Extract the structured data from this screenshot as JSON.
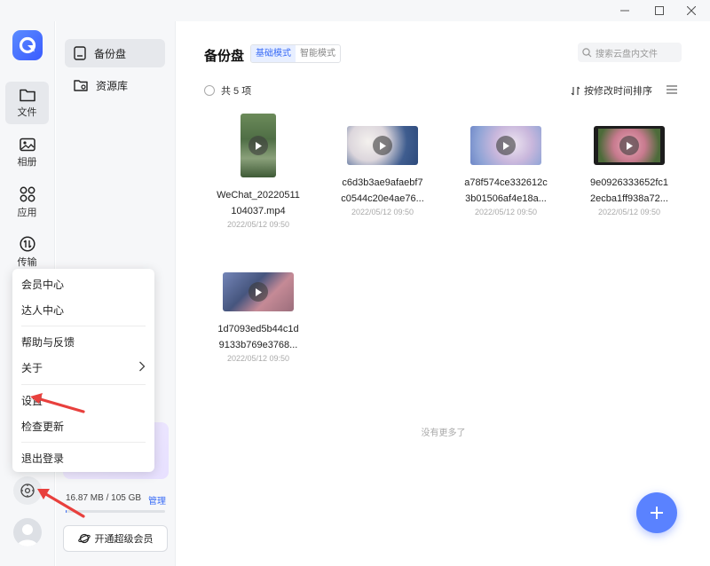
{
  "window": {
    "minimize_icon": "minimize-icon",
    "maximize_icon": "maximize-icon",
    "close_icon": "close-icon"
  },
  "rail": {
    "items": [
      {
        "label": "文件",
        "icon": "folder-icon"
      },
      {
        "label": "相册",
        "icon": "photo-icon"
      },
      {
        "label": "应用",
        "icon": "apps-icon"
      },
      {
        "label": "传输",
        "icon": "transfer-icon"
      }
    ]
  },
  "nav2": {
    "items": [
      {
        "label": "备份盘",
        "icon": "backup-disk-icon"
      },
      {
        "label": "资源库",
        "icon": "library-icon"
      }
    ],
    "quota": {
      "text": "16.87 MB / 105 GB",
      "manage": "管理",
      "used_fraction": 0.0002
    },
    "vip_button": "开通超级会员"
  },
  "main": {
    "title": "备份盘",
    "modes": [
      "基础模式",
      "智能模式"
    ],
    "search_placeholder": "搜索云盘内文件",
    "count": "共 5 项",
    "sort": "按修改时间排序",
    "files": [
      {
        "name1": "WeChat_20220511",
        "name2": "104037.mp4",
        "date": "2022/05/12 09:50"
      },
      {
        "name1": "c6d3b3ae9afaebf7",
        "name2": "c0544c20e4ae76...",
        "date": "2022/05/12 09:50"
      },
      {
        "name1": "a78f574ce332612c",
        "name2": "3b01506af4e18a...",
        "date": "2022/05/12 09:50"
      },
      {
        "name1": "9e0926333652fc1",
        "name2": "2ecba1ff938a72...",
        "date": "2022/05/12 09:50"
      },
      {
        "name1": "1d7093ed5b44c1d",
        "name2": "9133b769e3768...",
        "date": "2022/05/12 09:50"
      }
    ],
    "no_more": "没有更多了"
  },
  "menu": {
    "items": [
      "会员中心",
      "达人中心",
      "帮助与反馈",
      "关于",
      "设置",
      "检查更新",
      "退出登录"
    ]
  },
  "colors": {
    "accent": "#3a6cf6",
    "fab": "#5a82ff",
    "annotation_arrow": "#e8403d"
  }
}
